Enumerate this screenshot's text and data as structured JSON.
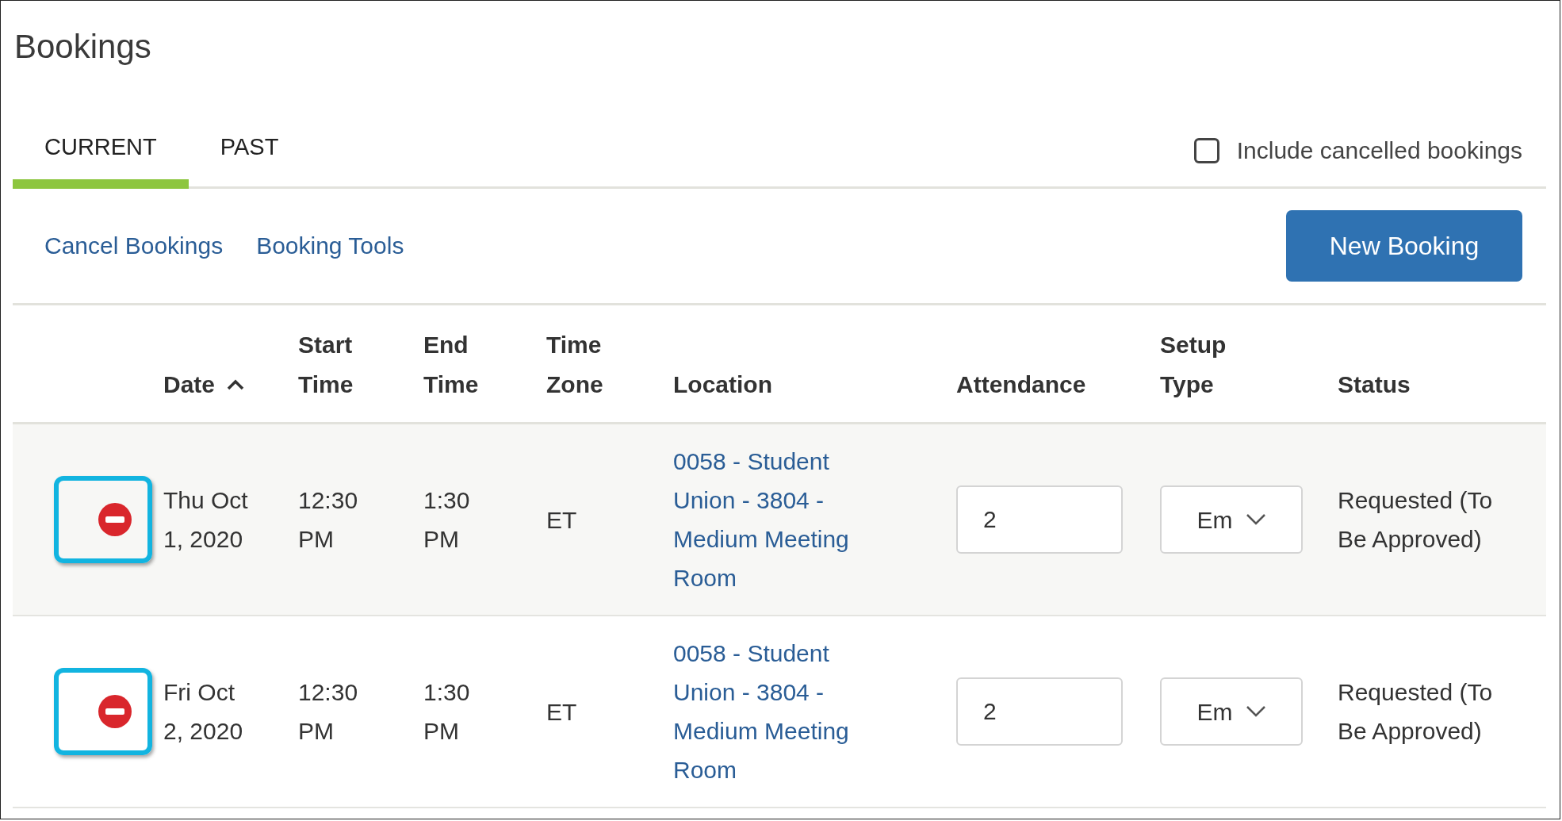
{
  "title": "Bookings",
  "tabs": [
    {
      "label": "CURRENT",
      "selected": true
    },
    {
      "label": "PAST",
      "selected": false
    }
  ],
  "include_cancelled": {
    "label": "Include cancelled bookings",
    "checked": false
  },
  "links": [
    "Cancel Bookings",
    "Booking Tools"
  ],
  "new_booking_button": "New Booking",
  "table": {
    "columns": [
      {
        "label": "Date",
        "sorted": true
      },
      {
        "label": "Start Time",
        "sorted": false
      },
      {
        "label": "End Time",
        "sorted": false
      },
      {
        "label": "Time Zone",
        "sorted": false
      },
      {
        "label": "Location",
        "sorted": false
      },
      {
        "label": "Attendance",
        "sorted": false
      },
      {
        "label": "Setup Type",
        "sorted": false
      },
      {
        "label": "Status",
        "sorted": false
      }
    ],
    "rows": [
      {
        "highlighted": true,
        "date": "Thu Oct 1, 2020",
        "start": "12:30 PM",
        "end": "1:30 PM",
        "time_zone": "ET",
        "location": "0058 - Student Union - 3804 - Medium Meeting Room",
        "attendance": "2",
        "setup_type": "Em",
        "status": "Requested (To Be Approved)"
      },
      {
        "highlighted": true,
        "date": "Fri Oct 2, 2020",
        "start": "12:30 PM",
        "end": "1:30 PM",
        "time_zone": "ET",
        "location": "0058 - Student Union - 3804 - Medium Meeting Room",
        "attendance": "2",
        "setup_type": "Em",
        "status": "Requested (To Be Approved)"
      }
    ]
  }
}
